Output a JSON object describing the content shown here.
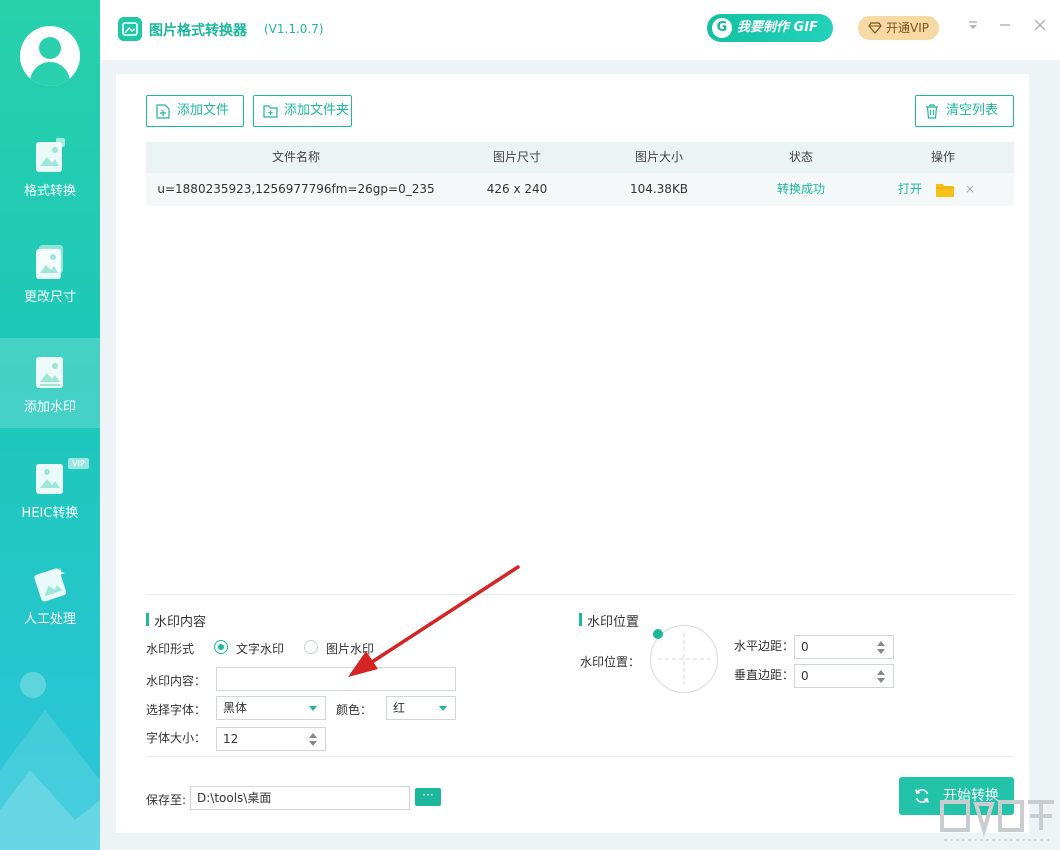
{
  "app": {
    "title": "图片格式转换器",
    "version": "(V1.1.0.7)"
  },
  "header": {
    "gif_button": "我要制作 GIF",
    "gif_letter": "G",
    "vip_button": "开通VIP"
  },
  "sidebar": {
    "items": [
      {
        "label": "格式转换"
      },
      {
        "label": "更改尺寸"
      },
      {
        "label": "添加水印",
        "active": true
      },
      {
        "label": "HEIC转换",
        "badge": "VIP"
      },
      {
        "label": "人工处理"
      }
    ]
  },
  "toolbar": {
    "add_file": "添加文件",
    "add_folder": "添加文件夹",
    "clear_list": "清空列表"
  },
  "table": {
    "headers": [
      "文件名称",
      "图片尺寸",
      "图片大小",
      "状态",
      "操作"
    ],
    "rows": [
      {
        "name": "u=1880235923,1256977796fm=26gp=0_235",
        "dimensions": "426 x 240",
        "size": "104.38KB",
        "status": "转换成功",
        "open": "打开",
        "delete": "×"
      }
    ]
  },
  "watermark_content": {
    "title": "水印内容",
    "type_label": "水印形式",
    "option_text": "文字水印",
    "option_image": "图片水印",
    "selected": "text",
    "content_label": "水印内容：",
    "content_value": "",
    "font_label": "选择字体：",
    "font_value": "黑体",
    "color_label": "颜色：",
    "color_value": "红",
    "size_label": "字体大小：",
    "size_value": "12"
  },
  "watermark_position": {
    "title": "水印位置",
    "position_label": "水印位置：",
    "h_margin_label": "水平边距：",
    "h_margin_value": "0",
    "v_margin_label": "垂直边距：",
    "v_margin_value": "0"
  },
  "footer": {
    "save_label": "保存至:",
    "save_path": "D:\\tools\\桌面",
    "browse": "···",
    "start_button": "开始转换"
  },
  "colors": {
    "accent": "#1db89c",
    "sidebar_top": "#28d0ac",
    "sidebar_bottom": "#2ec6dd",
    "annotation_arrow": "#d42424"
  }
}
